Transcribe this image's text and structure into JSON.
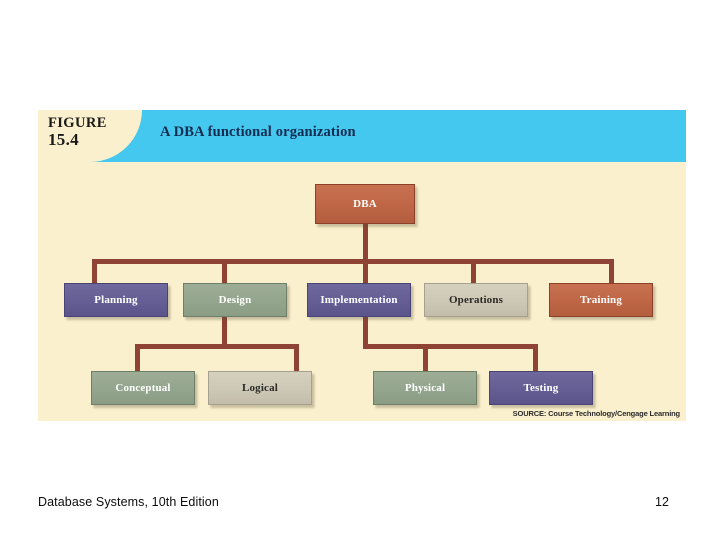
{
  "slide": {
    "background_color": "#ffffff",
    "footer": {
      "book_title": "Database Systems, 10th Edition",
      "page_number": "12"
    }
  },
  "figure": {
    "background_color": "#faf0cd",
    "banner_color": "#45c8f0",
    "tab": {
      "word": "FIGURE",
      "number": "15.4"
    },
    "title": "A DBA functional organization",
    "source": "SOURCE: Course Technology/Cengage Learning",
    "connector_color": "#8f4334"
  },
  "chart_data": {
    "type": "diagram",
    "diagram_type": "organization-chart",
    "title": "A DBA functional organization",
    "orientation": "top-down",
    "levels": 3,
    "palette": {
      "terracotta": "#be6646",
      "purple": "#655e94",
      "sage": "#94a58e",
      "tan": "#cdc7b5",
      "connector": "#8f4334",
      "background": "#faf0cd",
      "banner": "#45c8f0"
    },
    "nodes": [
      {
        "id": "dba",
        "label": "DBA",
        "level": 0,
        "parent": null,
        "color": "terracotta",
        "text_color": "#ffffff"
      },
      {
        "id": "planning",
        "label": "Planning",
        "level": 1,
        "parent": "dba",
        "color": "purple",
        "text_color": "#ffffff"
      },
      {
        "id": "design",
        "label": "Design",
        "level": 1,
        "parent": "dba",
        "color": "sage",
        "text_color": "#ffffff"
      },
      {
        "id": "implementation",
        "label": "Implementation",
        "level": 1,
        "parent": "dba",
        "color": "purple",
        "text_color": "#ffffff"
      },
      {
        "id": "operations",
        "label": "Operations",
        "level": 1,
        "parent": "dba",
        "color": "tan",
        "text_color": "#2a2a26"
      },
      {
        "id": "training",
        "label": "Training",
        "level": 1,
        "parent": "dba",
        "color": "terracotta",
        "text_color": "#ffffff"
      },
      {
        "id": "conceptual",
        "label": "Conceptual",
        "level": 2,
        "parent": "design",
        "color": "sage",
        "text_color": "#ffffff"
      },
      {
        "id": "logical",
        "label": "Logical",
        "level": 2,
        "parent": "design",
        "color": "tan",
        "text_color": "#2a2a26"
      },
      {
        "id": "physical",
        "label": "Physical",
        "level": 2,
        "parent": "implementation",
        "color": "sage",
        "text_color": "#ffffff"
      },
      {
        "id": "testing",
        "label": "Testing",
        "level": 2,
        "parent": "implementation",
        "color": "purple",
        "text_color": "#ffffff"
      }
    ],
    "edges": [
      {
        "from": "dba",
        "to": "planning"
      },
      {
        "from": "dba",
        "to": "design"
      },
      {
        "from": "dba",
        "to": "implementation"
      },
      {
        "from": "dba",
        "to": "operations"
      },
      {
        "from": "dba",
        "to": "training"
      },
      {
        "from": "design",
        "to": "conceptual"
      },
      {
        "from": "design",
        "to": "logical"
      },
      {
        "from": "implementation",
        "to": "physical"
      },
      {
        "from": "implementation",
        "to": "testing"
      }
    ]
  }
}
